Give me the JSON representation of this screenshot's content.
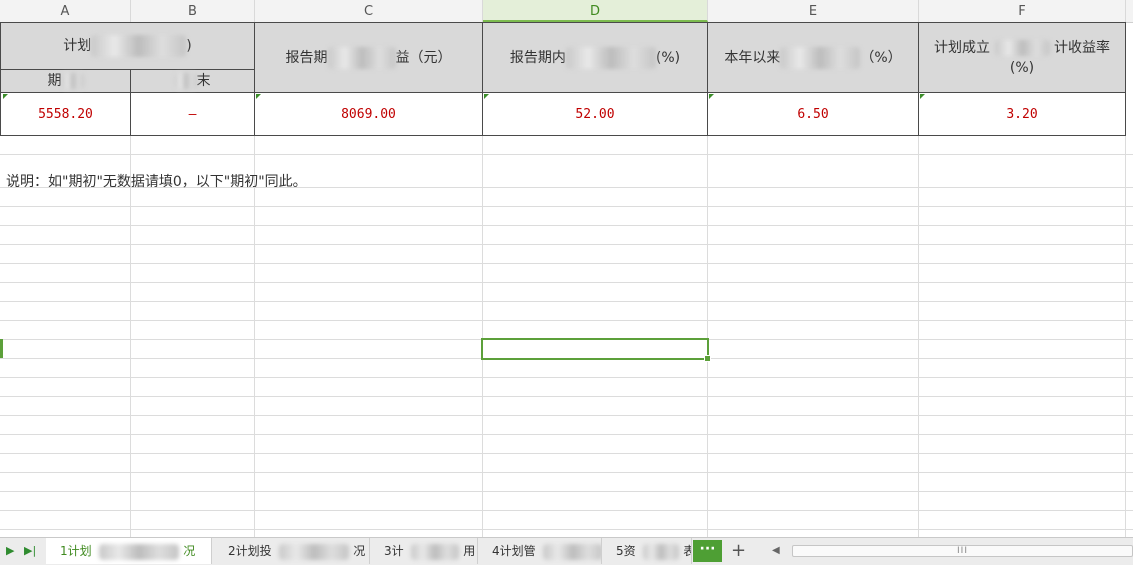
{
  "columns": [
    "A",
    "B",
    "C",
    "D",
    "E",
    "F"
  ],
  "active_column": "D",
  "header": {
    "group_title_left": "计划",
    "group_title_right": ")",
    "sub_a": "期",
    "sub_b": "末",
    "col_c_left": "报告期",
    "col_c_right": "益（元）",
    "col_d_left": "报告期内",
    "col_d_right": "(%)",
    "col_e_left": "本年以来",
    "col_e_right": "（%）",
    "col_f_line1_left": "计划成立",
    "col_f_line1_right": "计收益率",
    "col_f_line2": "(%)"
  },
  "row": [
    "5558.20",
    "—",
    "8069.00",
    "52.00",
    "6.50",
    "3.20"
  ],
  "note": "说明：如\"期初\"无数据请填0，以下\"期初\"同此。",
  "tabs": [
    {
      "left": "1计划",
      "right": "况"
    },
    {
      "left": "2计划投",
      "right": "况"
    },
    {
      "left": "3计",
      "right": "用"
    },
    {
      "left": "4计划管",
      "right": ""
    },
    {
      "left": "5资",
      "right": "表"
    }
  ],
  "more_button": "···",
  "add_button": "+",
  "scroll_grip": "III",
  "colors": {
    "accent": "#4e9f34",
    "data_text": "#c00000",
    "header_fill": "#d9d9d9"
  }
}
